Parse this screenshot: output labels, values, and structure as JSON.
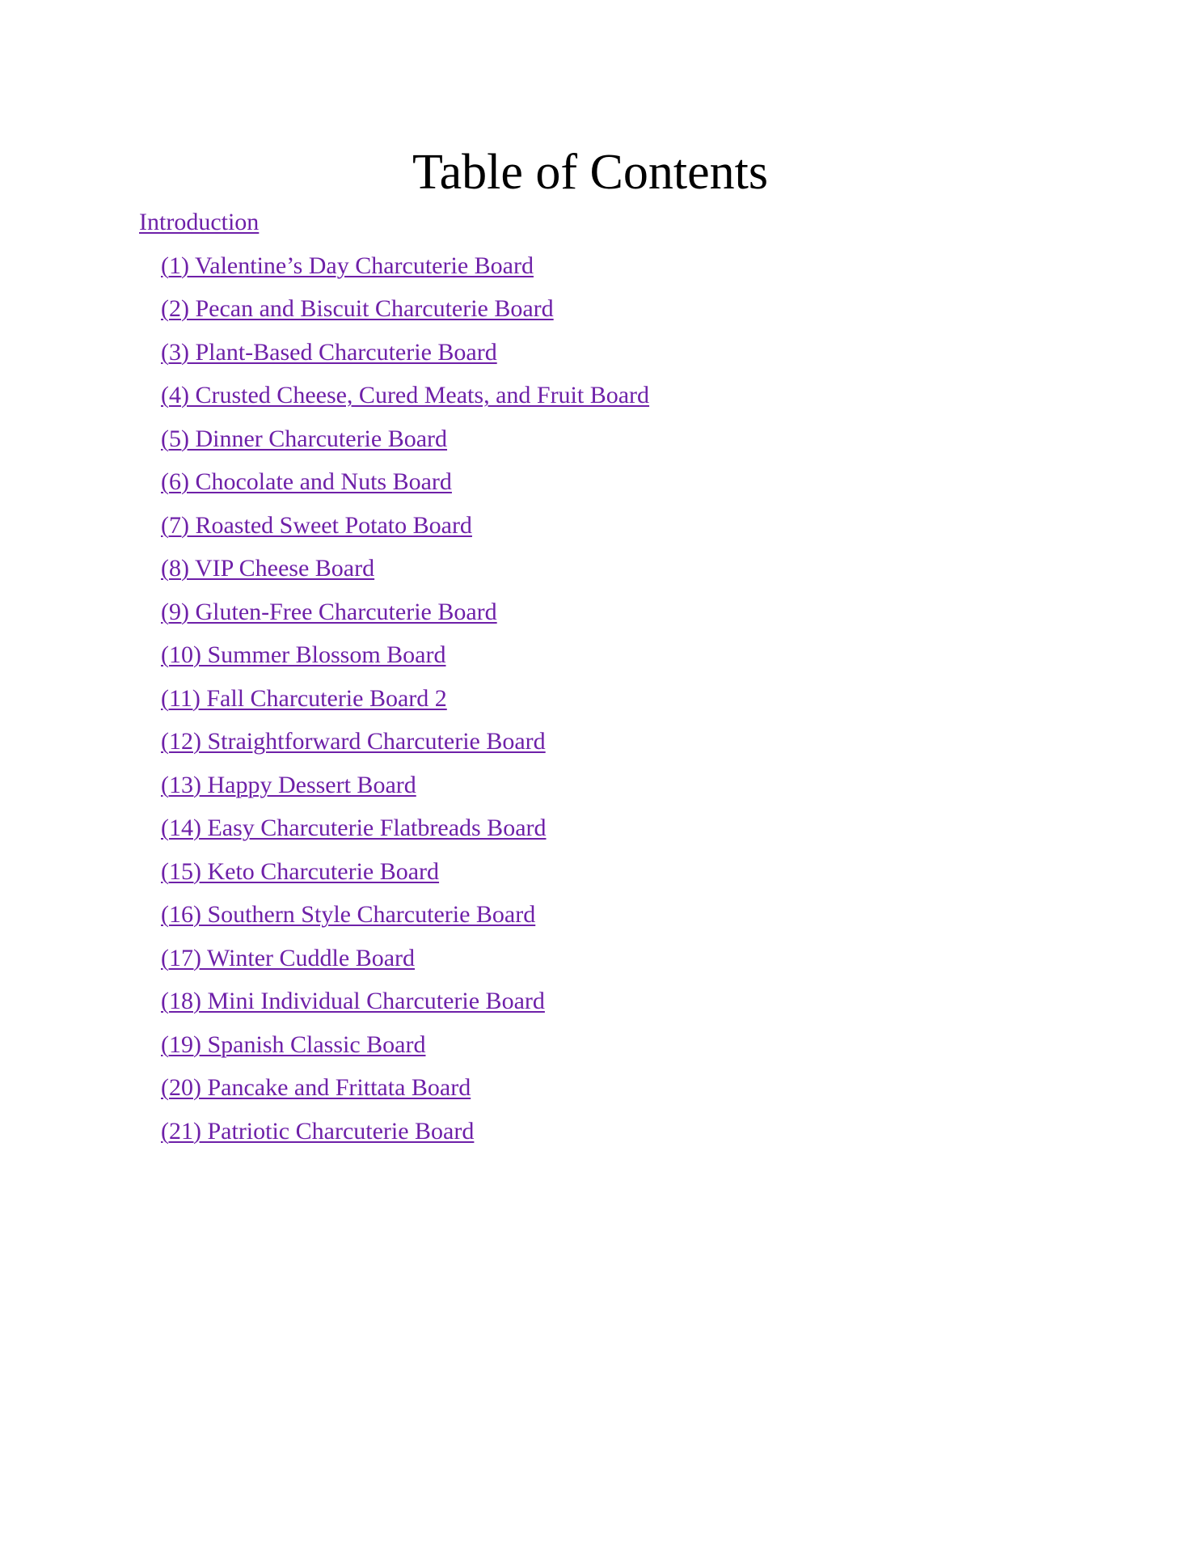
{
  "document": {
    "title": "Table of Contents",
    "link_color": "#6E20A8",
    "title_color": "#000000",
    "background_color": "#FFFFFF"
  },
  "toc": {
    "entries": [
      {
        "label": "Introduction",
        "level": 0
      },
      {
        "label": "(1) Valentine’s Day Charcuterie Board",
        "level": 1
      },
      {
        "label": "(2) Pecan and Biscuit Charcuterie Board",
        "level": 1
      },
      {
        "label": "(3) Plant-Based Charcuterie Board",
        "level": 1
      },
      {
        "label": "(4) Crusted Cheese, Cured Meats, and Fruit Board",
        "level": 1
      },
      {
        "label": "(5) Dinner Charcuterie Board",
        "level": 1
      },
      {
        "label": "(6) Chocolate and Nuts Board",
        "level": 1
      },
      {
        "label": "(7) Roasted Sweet Potato Board",
        "level": 1
      },
      {
        "label": "(8) VIP Cheese Board",
        "level": 1
      },
      {
        "label": "(9) Gluten-Free Charcuterie Board",
        "level": 1
      },
      {
        "label": "(10) Summer Blossom Board",
        "level": 1
      },
      {
        "label": "(11) Fall Charcuterie Board 2",
        "level": 1
      },
      {
        "label": "(12) Straightforward Charcuterie Board",
        "level": 1
      },
      {
        "label": "(13) Happy Dessert Board",
        "level": 1
      },
      {
        "label": "(14) Easy Charcuterie Flatbreads Board",
        "level": 1
      },
      {
        "label": "(15) Keto Charcuterie Board",
        "level": 1
      },
      {
        "label": "(16) Southern Style Charcuterie Board",
        "level": 1
      },
      {
        "label": "(17) Winter Cuddle Board",
        "level": 1
      },
      {
        "label": "(18) Mini Individual Charcuterie Board",
        "level": 1
      },
      {
        "label": "(19) Spanish Classic Board",
        "level": 1
      },
      {
        "label": "(20) Pancake and Frittata Board",
        "level": 1
      },
      {
        "label": "(21) Patriotic Charcuterie Board",
        "level": 1
      }
    ]
  }
}
